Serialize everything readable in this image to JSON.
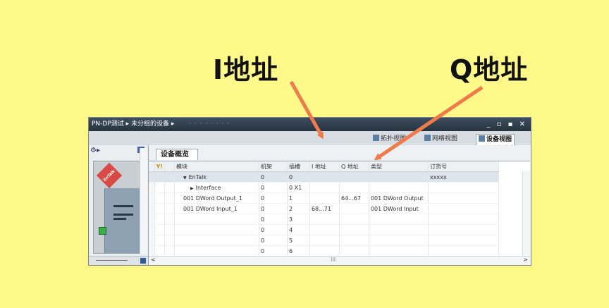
{
  "annotations": {
    "i_label": "I地址",
    "q_label": "Q地址",
    "arrow_color": "#f07a4a"
  },
  "window": {
    "title": "PN-DP测试 ▸ 未分组的设备 ▸",
    "title_blur": "· · · · · · · ·",
    "controls": "_ ▫ ▪ ✕"
  },
  "view_tabs": [
    {
      "label": "拓扑视图",
      "icon": "topology-icon",
      "active": false
    },
    {
      "label": "网络视图",
      "icon": "network-icon",
      "active": false
    },
    {
      "label": "设备视图",
      "icon": "device-icon",
      "active": true
    }
  ],
  "overview_tab": "设备概览",
  "device": {
    "logo_text": "EnTalk"
  },
  "table": {
    "columns": [
      "",
      "",
      "",
      "模块",
      "机架",
      "插槽",
      "I 地址",
      "Q 地址",
      "类型",
      "订货号"
    ],
    "rows": [
      {
        "module": "EnTalk",
        "expand": "▼",
        "indent": 1,
        "rack": "0",
        "slot": "0",
        "i_addr": "",
        "q_addr": "",
        "type": "",
        "order": "xxxxx",
        "selected": true
      },
      {
        "module": "Interface",
        "expand": "▶",
        "indent": 2,
        "rack": "0",
        "slot": "0 X1",
        "i_addr": "",
        "q_addr": "",
        "type": "",
        "order": "",
        "selected": false
      },
      {
        "module": "001 DWord Output_1",
        "expand": "",
        "indent": 1,
        "rack": "0",
        "slot": "1",
        "i_addr": "",
        "q_addr": "64...67",
        "type": "001 DWord Output",
        "order": "",
        "selected": false
      },
      {
        "module": "001 DWord Input_1",
        "expand": "",
        "indent": 1,
        "rack": "0",
        "slot": "2",
        "i_addr": "68...71",
        "q_addr": "",
        "type": "001 DWord Input",
        "order": "",
        "selected": false
      },
      {
        "module": "",
        "expand": "",
        "indent": 1,
        "rack": "0",
        "slot": "3",
        "i_addr": "",
        "q_addr": "",
        "type": "",
        "order": "",
        "selected": false
      },
      {
        "module": "",
        "expand": "",
        "indent": 1,
        "rack": "0",
        "slot": "4",
        "i_addr": "",
        "q_addr": "",
        "type": "",
        "order": "",
        "selected": false
      },
      {
        "module": "",
        "expand": "",
        "indent": 1,
        "rack": "0",
        "slot": "5",
        "i_addr": "",
        "q_addr": "",
        "type": "",
        "order": "",
        "selected": false
      },
      {
        "module": "",
        "expand": "",
        "indent": 1,
        "rack": "0",
        "slot": "6",
        "i_addr": "",
        "q_addr": "",
        "type": "",
        "order": "",
        "selected": false
      }
    ]
  },
  "scroll_glyph": "III"
}
